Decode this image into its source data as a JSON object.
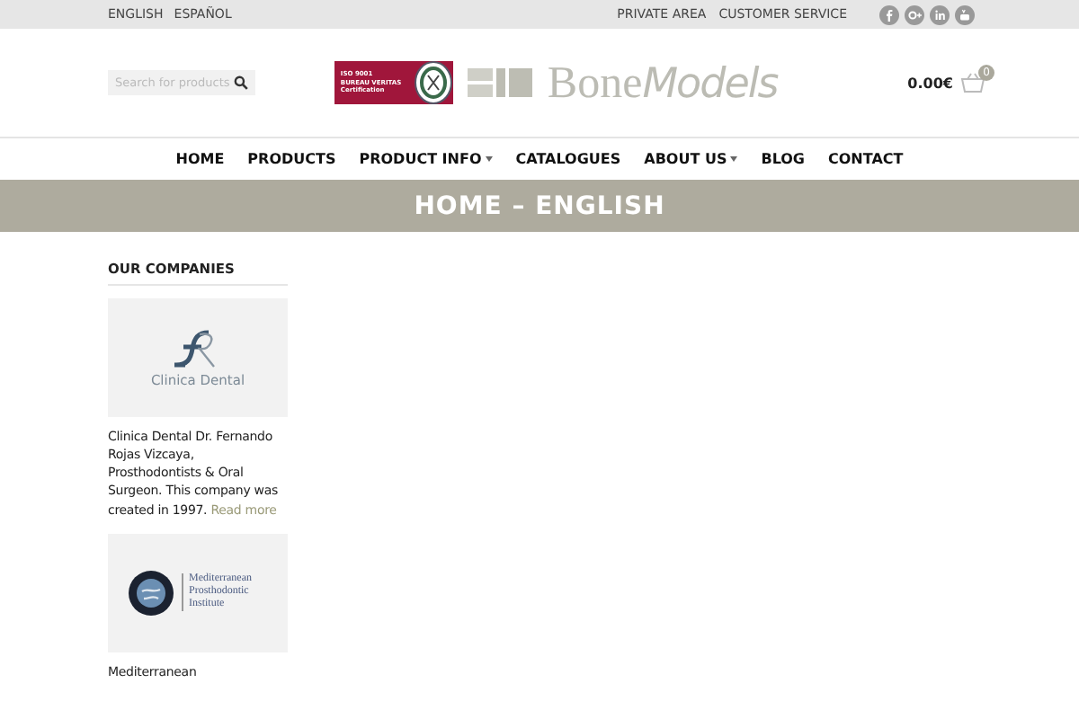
{
  "top_bar": {
    "languages": [
      "ENGLISH",
      "ESPAÑOL"
    ],
    "links": [
      "PRIVATE AREA",
      "CUSTOMER SERVICE"
    ]
  },
  "header": {
    "search": {
      "placeholder": "Search for products"
    },
    "badge": {
      "lines": [
        "ISO 9001",
        "BUREAU VERITAS",
        "Certification"
      ]
    },
    "logo": {
      "name": "Bone",
      "script": "Models"
    },
    "cart": {
      "total": "0.00€",
      "count": "0"
    }
  },
  "nav": [
    {
      "label": "HOME",
      "dropdown": false
    },
    {
      "label": "PRODUCTS",
      "dropdown": false
    },
    {
      "label": "PRODUCT INFO",
      "dropdown": true
    },
    {
      "label": "CATALOGUES",
      "dropdown": false
    },
    {
      "label": "ABOUT US",
      "dropdown": true
    },
    {
      "label": "BLOG",
      "dropdown": false
    },
    {
      "label": "CONTACT",
      "dropdown": false
    }
  ],
  "page_title": "HOME – ENGLISH",
  "sidebar": {
    "heading": "OUR COMPANIES",
    "companies": [
      {
        "kind": "clinic",
        "logo_text": "Clinica Dental",
        "text": "Clinica Dental Dr. Fernando Rojas Vizcaya, Prosthodontists & Oral Surgeon. This company was created in 1997.",
        "link": "Read more"
      },
      {
        "kind": "institute",
        "logo_text": "Mediterranean Prosthodontic Institute",
        "text": "Mediterranean"
      }
    ]
  }
}
